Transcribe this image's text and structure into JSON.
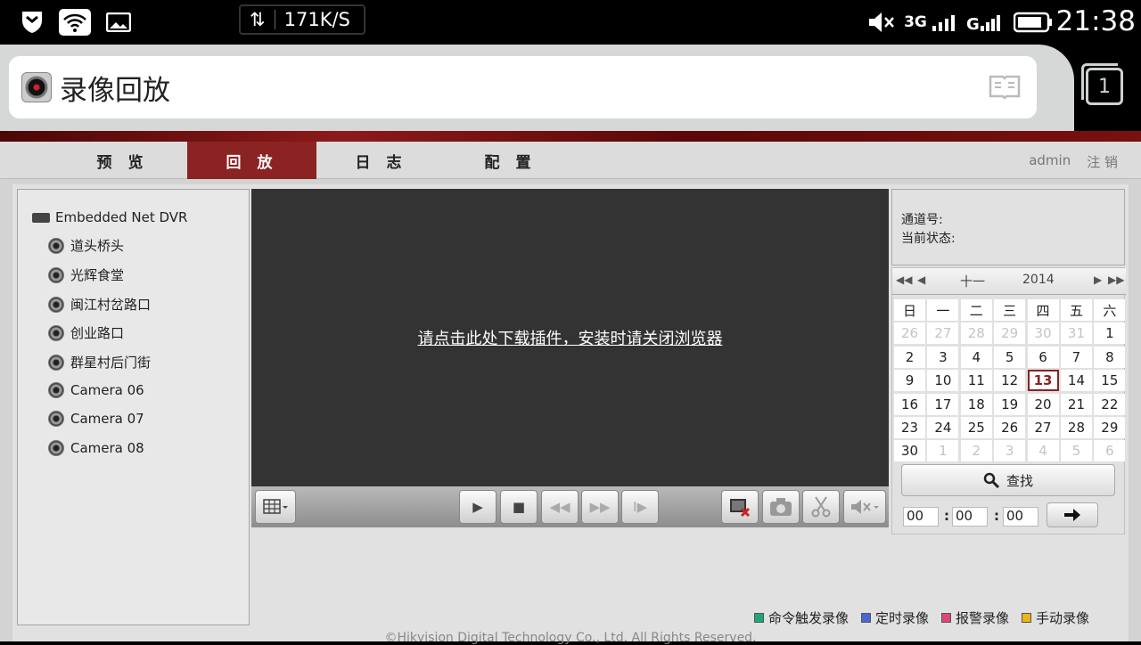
{
  "statusbar": {
    "net_speed": "171K/S",
    "network_types": "3G",
    "clock": "21:38"
  },
  "browser": {
    "page_title": "录像回放",
    "tab_count": "1"
  },
  "nav": {
    "tabs": [
      "预 览",
      "回 放",
      "日 志",
      "配 置"
    ],
    "active_index": 1,
    "user": "admin",
    "logout": "注 销"
  },
  "tree": {
    "root": "Embedded Net DVR",
    "cameras": [
      "道头桥头",
      "光辉食堂",
      "闽江村岔路口",
      "创业路口",
      "群星村后门街",
      "Camera 06",
      "Camera 07",
      "Camera 08"
    ]
  },
  "player": {
    "plugin_message": "请点击此处下载插件，安装时请关闭浏览器"
  },
  "info": {
    "channel_label": "通道号:",
    "status_label": "当前状态:"
  },
  "calendar": {
    "month": "十一",
    "year": "2014",
    "weekdays": [
      "日",
      "一",
      "二",
      "三",
      "四",
      "五",
      "六"
    ],
    "days": [
      {
        "d": "26",
        "faded": true
      },
      {
        "d": "27",
        "faded": true
      },
      {
        "d": "28",
        "faded": true
      },
      {
        "d": "29",
        "faded": true
      },
      {
        "d": "30",
        "faded": true
      },
      {
        "d": "31",
        "faded": true
      },
      {
        "d": "1"
      },
      {
        "d": "2"
      },
      {
        "d": "3"
      },
      {
        "d": "4"
      },
      {
        "d": "5"
      },
      {
        "d": "6"
      },
      {
        "d": "7"
      },
      {
        "d": "8"
      },
      {
        "d": "9"
      },
      {
        "d": "10"
      },
      {
        "d": "11"
      },
      {
        "d": "12"
      },
      {
        "d": "13",
        "today": true
      },
      {
        "d": "14"
      },
      {
        "d": "15"
      },
      {
        "d": "16"
      },
      {
        "d": "17"
      },
      {
        "d": "18"
      },
      {
        "d": "19"
      },
      {
        "d": "20"
      },
      {
        "d": "21"
      },
      {
        "d": "22"
      },
      {
        "d": "23"
      },
      {
        "d": "24"
      },
      {
        "d": "25"
      },
      {
        "d": "26"
      },
      {
        "d": "27"
      },
      {
        "d": "28"
      },
      {
        "d": "29"
      },
      {
        "d": "30"
      },
      {
        "d": "1",
        "faded": true
      },
      {
        "d": "2",
        "faded": true
      },
      {
        "d": "3",
        "faded": true
      },
      {
        "d": "4",
        "faded": true
      },
      {
        "d": "5",
        "faded": true
      },
      {
        "d": "6",
        "faded": true
      }
    ]
  },
  "search": {
    "label": "查找",
    "hour": "00",
    "minute": "00",
    "second": "00"
  },
  "legend": [
    {
      "label": "命令触发录像",
      "color": "#21a67a"
    },
    {
      "label": "定时录像",
      "color": "#4a66d6"
    },
    {
      "label": "报警录像",
      "color": "#e0457a"
    },
    {
      "label": "手动录像",
      "color": "#e8b51b"
    }
  ],
  "footer": "©Hikvision Digital Technology Co., Ltd. All Rights Reserved."
}
